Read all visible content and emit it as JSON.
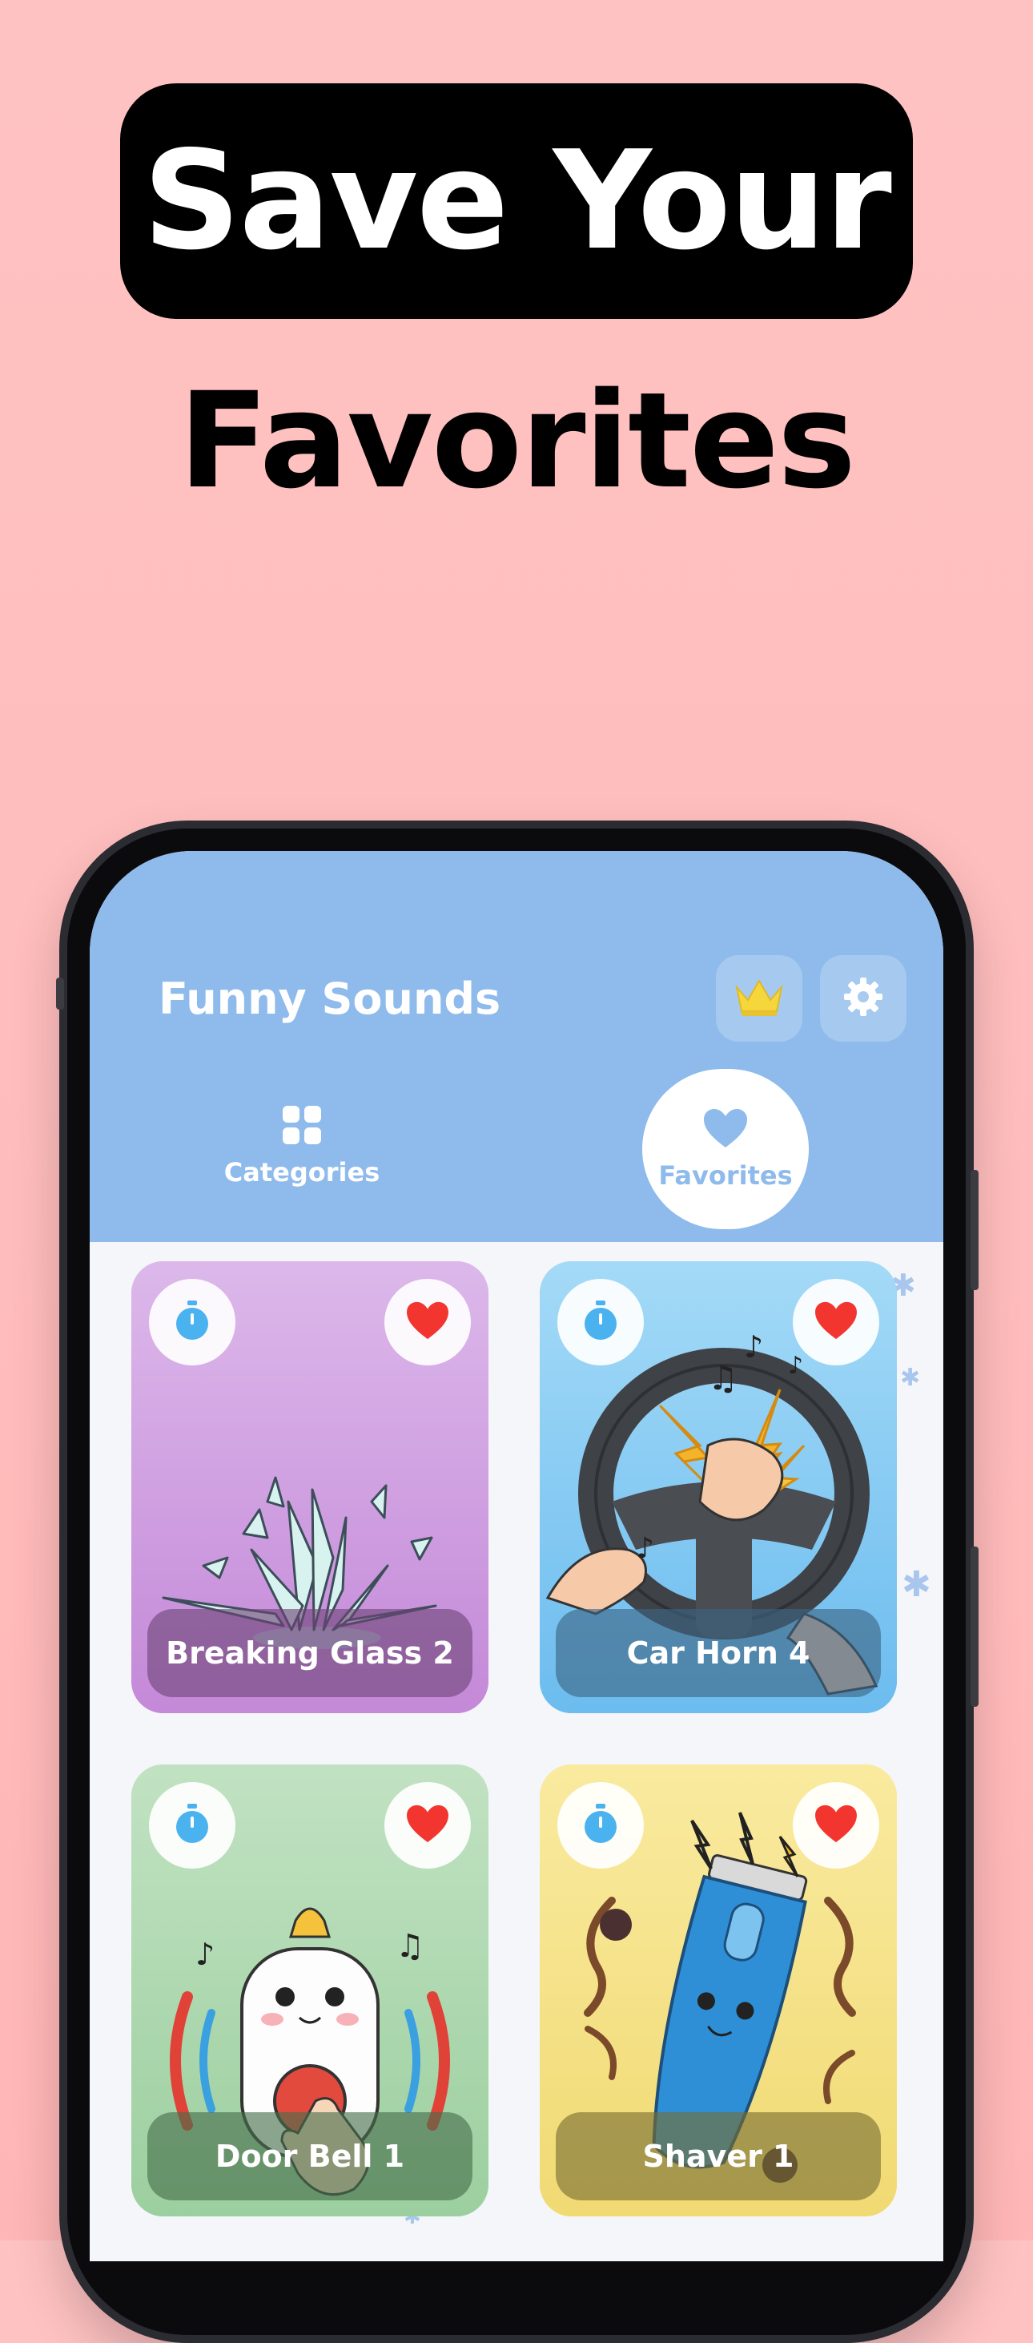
{
  "headline": {
    "line1": "Save Your",
    "line2": "Favorites"
  },
  "app": {
    "title": "Funny Sounds",
    "header_icons": [
      "crown-icon",
      "gear-icon"
    ],
    "tabs": [
      {
        "label": "Categories",
        "icon": "grid-icon",
        "selected": false
      },
      {
        "label": "Favorites",
        "icon": "heart-icon",
        "selected": true
      }
    ]
  },
  "cards": [
    {
      "label": "Breaking Glass 2",
      "color": "#cf9ee0",
      "favorited": true
    },
    {
      "label": "Car Horn 4",
      "color": "#86c9f2",
      "favorited": true
    },
    {
      "label": "Door Bell 1",
      "color": "#b0d9b3",
      "favorited": true
    },
    {
      "label": "Shaver 1",
      "color": "#f6e38d",
      "favorited": true
    }
  ],
  "colors": {
    "background": "#ffbfbf",
    "header": "#8ebbeb",
    "heart": "#f2362f",
    "timer": "#4ab2ef",
    "crown": "#f5d73c"
  }
}
